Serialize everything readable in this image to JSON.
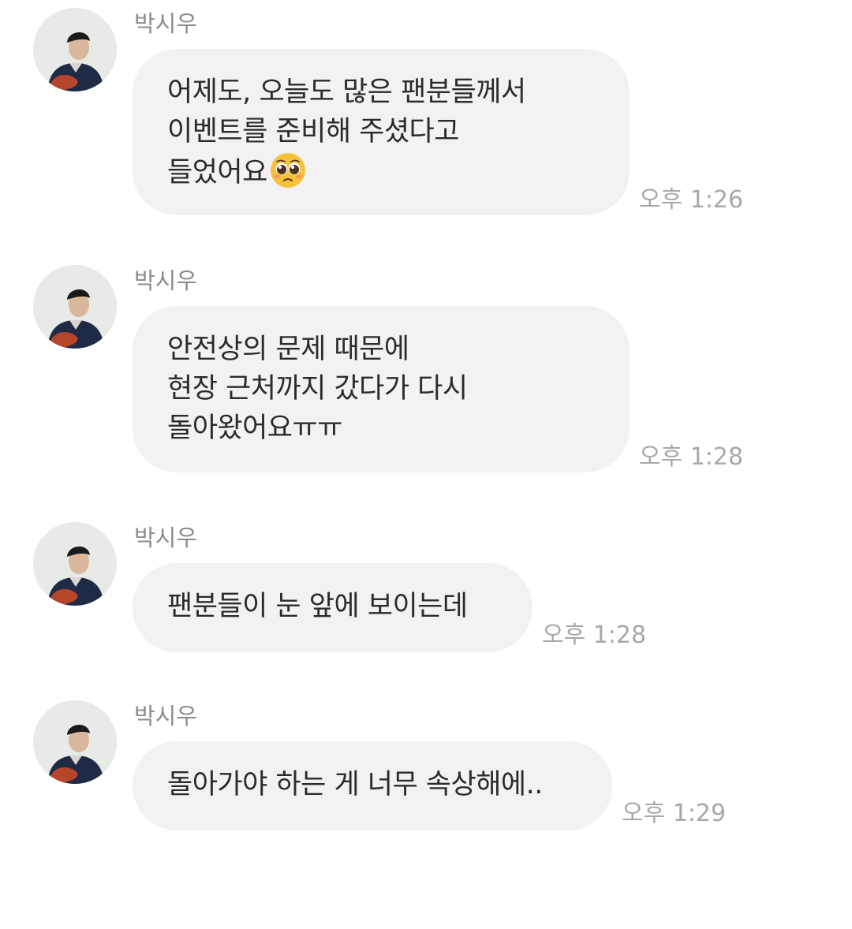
{
  "chat": {
    "messages": [
      {
        "sender": "박시우",
        "text": "어제도, 오늘도 많은 팬분들께서\n이벤트를 준비해 주셨다고\n들었어요",
        "emoji": "pleading-face",
        "time": "오후 1:26"
      },
      {
        "sender": "박시우",
        "text": "안전상의 문제 때문에\n현장 근처까지 갔다가 다시\n돌아왔어요ㅠㅠ",
        "time": "오후 1:28"
      },
      {
        "sender": "박시우",
        "text": "팬분들이 눈 앞에 보이는데",
        "time": "오후 1:28"
      },
      {
        "sender": "박시우",
        "text": "돌아가야 하는 게 너무 속상해에..",
        "time": "오후 1:29"
      }
    ]
  },
  "colors": {
    "bubble": "#f2f2f4",
    "text": "#2b2b2b",
    "sender": "#8c8c8c",
    "time": "#a8a8a8"
  }
}
